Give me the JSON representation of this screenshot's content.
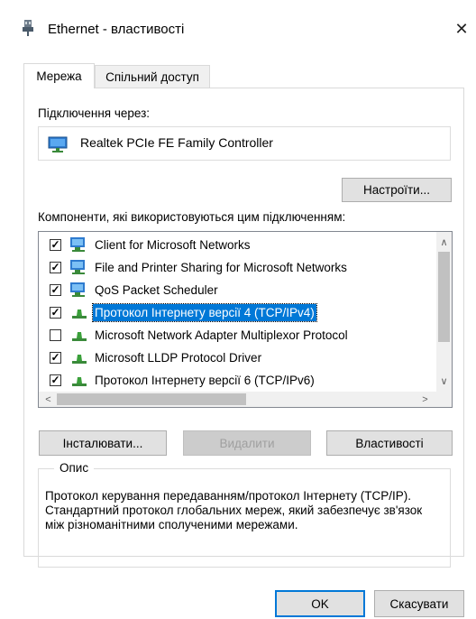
{
  "window": {
    "title": "Ethernet - властивості",
    "close_glyph": "✕"
  },
  "tabs": [
    {
      "label": "Мережа",
      "active": true
    },
    {
      "label": "Спільний доступ",
      "active": false
    }
  ],
  "connect_label": "Підключення через:",
  "device_name": "Realtek PCIe FE Family Controller",
  "configure_button": "Настроїти...",
  "components_label": "Компоненти, які використовуються цим підключенням:",
  "components": [
    {
      "label": "Client for Microsoft Networks",
      "checked": true,
      "selected": false,
      "icon": "network-client-icon"
    },
    {
      "label": "File and Printer Sharing for Microsoft Networks",
      "checked": true,
      "selected": false,
      "icon": "network-service-icon"
    },
    {
      "label": "QoS Packet Scheduler",
      "checked": true,
      "selected": false,
      "icon": "network-service-icon"
    },
    {
      "label": "Протокол Інтернету версії 4 (TCP/IPv4)",
      "checked": true,
      "selected": true,
      "icon": "protocol-icon"
    },
    {
      "label": "Microsoft Network Adapter Multiplexor Protocol",
      "checked": false,
      "selected": false,
      "icon": "protocol-icon"
    },
    {
      "label": "Microsoft LLDP Protocol Driver",
      "checked": true,
      "selected": false,
      "icon": "protocol-icon"
    },
    {
      "label": "Протокол Інтернету версії 6 (TCP/IPv6)",
      "checked": true,
      "selected": false,
      "icon": "protocol-icon"
    }
  ],
  "buttons": {
    "install": "Інсталювати...",
    "uninstall": "Видалити",
    "properties": "Властивості",
    "ok": "OK",
    "cancel": "Скасувати"
  },
  "description": {
    "legend": "Опис",
    "text": "Протокол керування передаванням/протокол Інтернету (TCP/IP). Стандартний протокол глобальних мереж, який забезпечує зв'язок між різноманітними сполученими мережами."
  },
  "colors": {
    "accent": "#0078d7",
    "button_bg": "#e1e1e1"
  }
}
